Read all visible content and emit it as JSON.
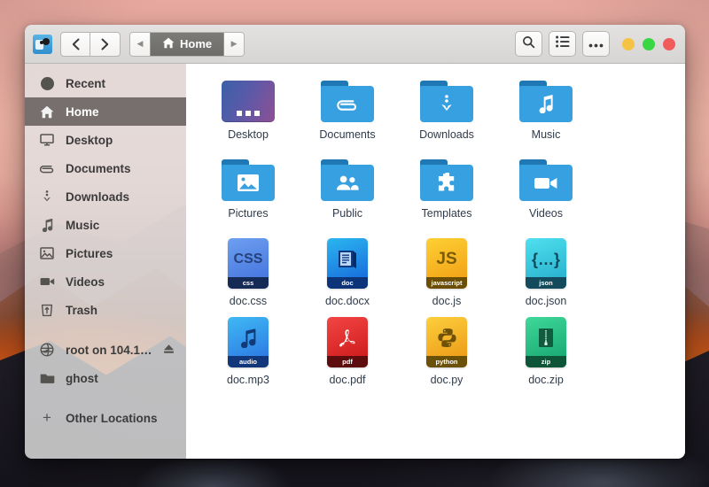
{
  "window": {
    "app_icon": "files-app-icon",
    "nav": {
      "back": "back-arrow",
      "forward": "forward-arrow"
    },
    "breadcrumb": {
      "left_arrow": "◀",
      "right_arrow": "▶",
      "current": "Home",
      "icon": "home-icon"
    },
    "actions": {
      "search": "search-icon",
      "view_list": "list-view-icon",
      "menu": "more-options-icon"
    },
    "traffic_lights": [
      {
        "name": "minimize-button",
        "color": "#f5c344"
      },
      {
        "name": "maximize-button",
        "color": "#3ad644"
      },
      {
        "name": "close-button",
        "color": "#f05b5b"
      }
    ]
  },
  "sidebar": {
    "items": [
      {
        "label": "Recent",
        "icon": "clock-icon",
        "selected": false
      },
      {
        "label": "Home",
        "icon": "home-icon",
        "selected": true
      },
      {
        "label": "Desktop",
        "icon": "monitor-icon",
        "selected": false
      },
      {
        "label": "Documents",
        "icon": "paperclip-icon",
        "selected": false
      },
      {
        "label": "Downloads",
        "icon": "download-icon",
        "selected": false
      },
      {
        "label": "Music",
        "icon": "music-note-icon",
        "selected": false
      },
      {
        "label": "Pictures",
        "icon": "image-icon",
        "selected": false
      },
      {
        "label": "Videos",
        "icon": "camcorder-icon",
        "selected": false
      },
      {
        "label": "Trash",
        "icon": "trash-icon",
        "selected": false
      }
    ],
    "devices": [
      {
        "label": "root on 104.13…",
        "icon": "network-drive-icon",
        "eject": "eject-icon"
      },
      {
        "label": "ghost",
        "icon": "folder-icon"
      }
    ],
    "other_locations": {
      "label": "Other Locations",
      "icon": "plus-icon"
    }
  },
  "files": [
    {
      "name": "Desktop",
      "kind": "desktop"
    },
    {
      "name": "Documents",
      "kind": "folder",
      "emblem": "paperclip-icon"
    },
    {
      "name": "Downloads",
      "kind": "folder",
      "emblem": "download-icon"
    },
    {
      "name": "Music",
      "kind": "folder",
      "emblem": "music-note-icon"
    },
    {
      "name": "Pictures",
      "kind": "folder",
      "emblem": "image-icon"
    },
    {
      "name": "Public",
      "kind": "folder",
      "emblem": "people-icon"
    },
    {
      "name": "Templates",
      "kind": "folder",
      "emblem": "puzzle-icon"
    },
    {
      "name": "Videos",
      "kind": "folder",
      "emblem": "camcorder-icon"
    },
    {
      "name": "doc.css",
      "kind": "file",
      "glyph": "CSS",
      "tag": "css",
      "bg": "linear-gradient(160deg,#6d9ff0 0%,#3f6fdb 100%)",
      "fg": "#26427d",
      "tagbg": "#162a56"
    },
    {
      "name": "doc.docx",
      "kind": "file",
      "glyph": "doc-icon",
      "tag": "doc",
      "bg": "linear-gradient(160deg,#2bb6f0 0%,#1560d8 100%)",
      "fg": "#10336e",
      "tagbg": "#0d3478"
    },
    {
      "name": "doc.js",
      "kind": "file",
      "glyph": "JS",
      "tag": "javascript",
      "bg": "linear-gradient(160deg,#fdd033 0%,#f09a12 100%)",
      "fg": "#7a5a08",
      "tagbg": "#6b4d06"
    },
    {
      "name": "doc.json",
      "kind": "file",
      "glyph": "{…}",
      "tag": "json",
      "bg": "linear-gradient(160deg,#4fe0ef 0%,#23a9c8 100%)",
      "fg": "#0e4a5c",
      "tagbg": "#134a5c"
    },
    {
      "name": "doc.mp3",
      "kind": "file",
      "glyph": "music-note-icon",
      "tag": "audio",
      "bg": "linear-gradient(160deg,#3fb9f4 0%,#2a6fe0 100%)",
      "fg": "#123a77",
      "tagbg": "#11367a"
    },
    {
      "name": "doc.pdf",
      "kind": "file",
      "glyph": "pdf-icon",
      "tag": "pdf",
      "bg": "linear-gradient(160deg,#f34545 0%,#c81515 100%)",
      "fg": "#ffffff",
      "tagbg": "#5c0c0c"
    },
    {
      "name": "doc.py",
      "kind": "file",
      "glyph": "python-icon",
      "tag": "python",
      "bg": "linear-gradient(160deg,#fccf3c 0%,#eb9312 100%)",
      "fg": "#6f5207",
      "tagbg": "#6b5008"
    },
    {
      "name": "doc.zip",
      "kind": "file",
      "glyph": "zip-icon",
      "tag": "zip",
      "bg": "linear-gradient(160deg,#3fd89a 0%,#13a06b 100%)",
      "fg": "#0f5c3e",
      "tagbg": "#0d5438"
    }
  ]
}
